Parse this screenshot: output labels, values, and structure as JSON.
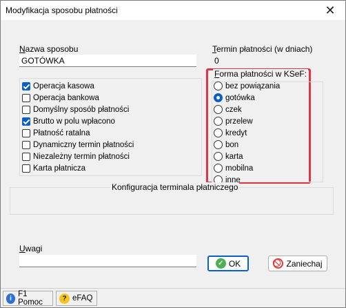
{
  "window": {
    "title": "Modyfikacja sposobu płatności",
    "close_glyph": "✕"
  },
  "form": {
    "name_label_first": "N",
    "name_label_rest": "azwa sposobu",
    "name_value": "GOTÓWKA",
    "term_label_first": "T",
    "term_label_rest": "ermin płatności (w dniach)",
    "term_value": "0"
  },
  "checkboxes": [
    {
      "label": "Operacja kasowa",
      "checked": true
    },
    {
      "label": "Operacja bankowa",
      "checked": false
    },
    {
      "label": "Domyślny sposób płatności",
      "checked": false
    },
    {
      "label": "Brutto w polu wpłacono",
      "checked": true
    },
    {
      "label": "Płatność ratalna",
      "checked": false
    },
    {
      "label": "Dynamiczny termin płatności",
      "checked": false
    },
    {
      "label": "Niezależny termin płatności",
      "checked": false
    },
    {
      "label": "Karta płatnicza",
      "checked": false
    }
  ],
  "ksef": {
    "title_first": "F",
    "title_rest": "orma płatności w KSeF:",
    "highlight_color": "#dc3545",
    "options": [
      {
        "label": "bez powiązania",
        "selected": false
      },
      {
        "label": "gotówka",
        "selected": true
      },
      {
        "label": "czek",
        "selected": false
      },
      {
        "label": "przelew",
        "selected": false
      },
      {
        "label": "kredyt",
        "selected": false
      },
      {
        "label": "bon",
        "selected": false
      },
      {
        "label": "karta",
        "selected": false
      },
      {
        "label": "mobilna",
        "selected": false
      },
      {
        "label": "inne",
        "selected": false
      }
    ]
  },
  "terminal": {
    "title": "Konfiguracja terminala płatniczego"
  },
  "remarks": {
    "label_first": "U",
    "label_rest": "wagi",
    "value": ""
  },
  "buttons": {
    "ok_label": "OK",
    "ok_icon": "check-icon",
    "ok_icon_color": "#4caf50",
    "cancel_label": "Zaniechaj",
    "cancel_icon": "cancel-icon",
    "cancel_icon_color": "#e53935"
  },
  "statusbar": {
    "help_label": "F1 Pomoc",
    "help_icon": "info-icon",
    "faq_label": "eFAQ",
    "faq_icon": "help-icon"
  }
}
